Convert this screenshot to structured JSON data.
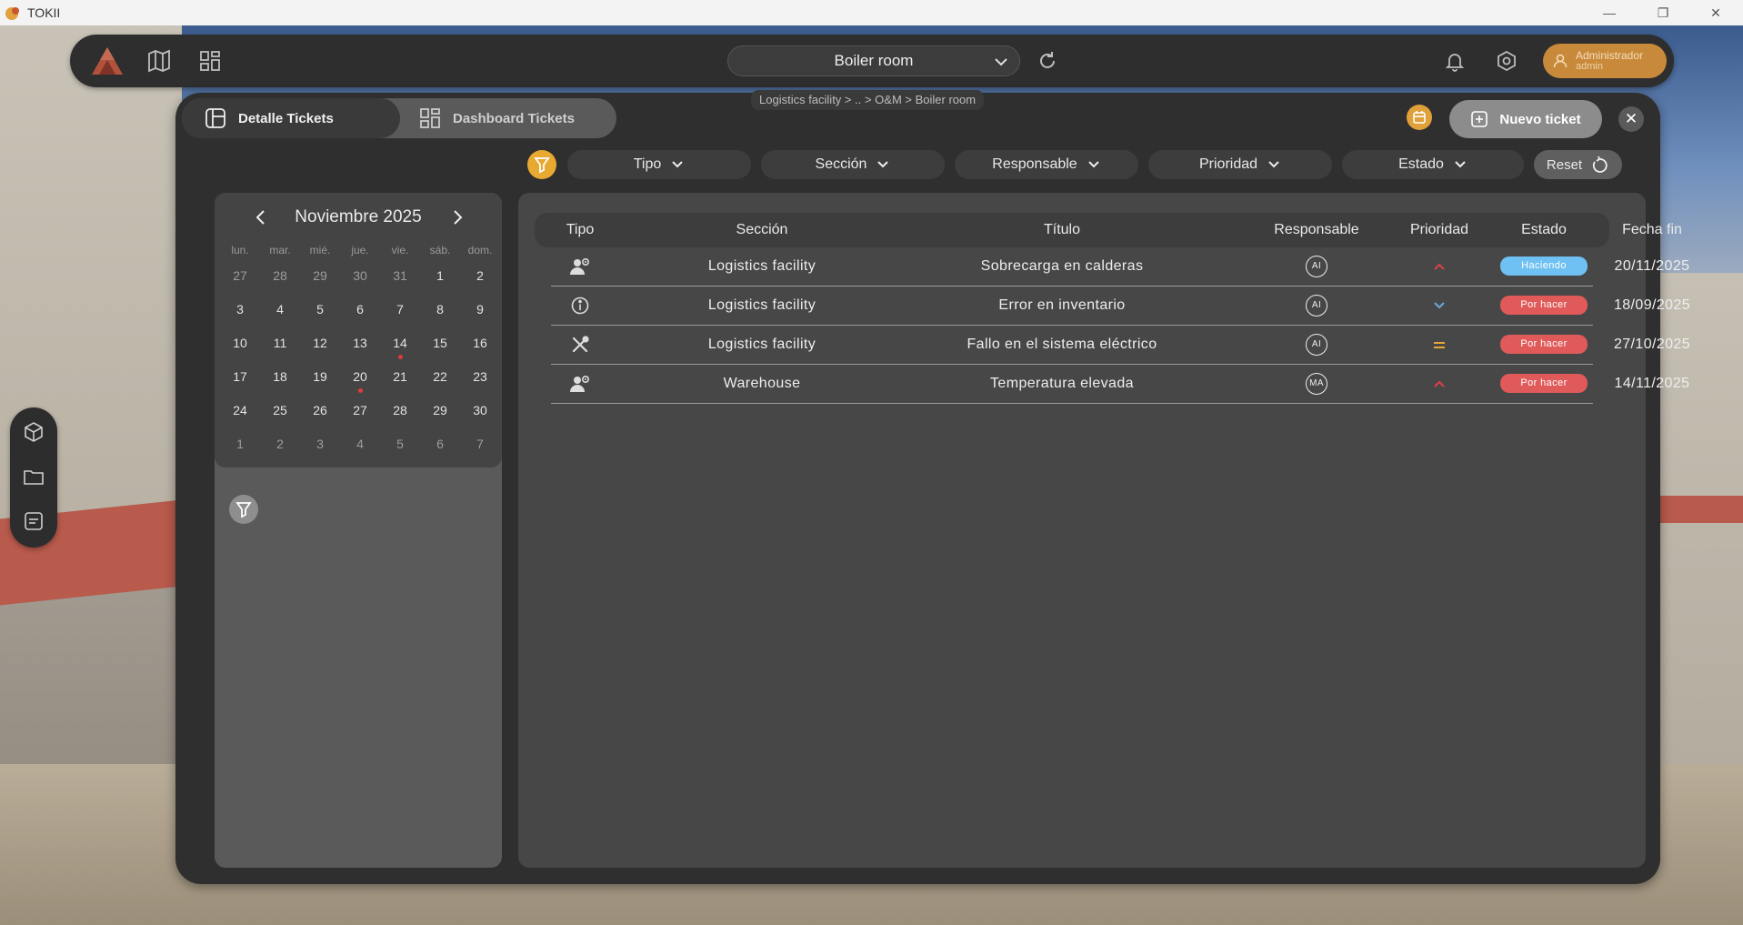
{
  "app": {
    "title": "TOKII"
  },
  "window_controls": {
    "minimize": "—",
    "maximize": "❐",
    "close": "✕"
  },
  "topbar": {
    "room": "Boiler room",
    "user": {
      "name": "Administrador",
      "role": "admin"
    }
  },
  "breadcrumb": "Logistics facility > .. > O&M > Boiler room",
  "tabs": [
    {
      "label": "Detalle Tickets",
      "active": true
    },
    {
      "label": "Dashboard Tickets",
      "active": false
    }
  ],
  "actions": {
    "new_ticket": "Nuevo ticket",
    "close": "✕",
    "reset": "Reset"
  },
  "filters": [
    "Tipo",
    "Sección",
    "Responsable",
    "Prioridad",
    "Estado"
  ],
  "calendar": {
    "month_label": "Noviembre 2025",
    "weekdays": [
      "lun.",
      "mar.",
      "mié.",
      "jue.",
      "vie.",
      "sáb.",
      "dom."
    ],
    "weeks": [
      [
        "27",
        "28",
        "29",
        "30",
        "31",
        "1",
        "2"
      ],
      [
        "3",
        "4",
        "5",
        "6",
        "7",
        "8",
        "9"
      ],
      [
        "10",
        "11",
        "12",
        "13",
        "14",
        "15",
        "16"
      ],
      [
        "17",
        "18",
        "19",
        "20",
        "21",
        "22",
        "23"
      ],
      [
        "24",
        "25",
        "26",
        "27",
        "28",
        "29",
        "30"
      ],
      [
        "1",
        "2",
        "3",
        "4",
        "5",
        "6",
        "7"
      ]
    ],
    "marked_days": [
      "14",
      "20"
    ]
  },
  "table": {
    "headers": [
      "Tipo",
      "Sección",
      "Título",
      "Responsable",
      "Prioridad",
      "Estado",
      "Fecha fin"
    ],
    "rows": [
      {
        "type_icon": "person-gear-icon",
        "section": "Logistics facility",
        "title": "Sobrecarga en calderas",
        "owner": "AI",
        "priority": "high",
        "status": "Haciendo",
        "status_color": "#6ec1f2",
        "due": "20/11/2025"
      },
      {
        "type_icon": "info-icon",
        "section": "Logistics facility",
        "title": "Error en inventario",
        "owner": "AI",
        "priority": "low",
        "status": "Por hacer",
        "status_color": "#e05a5a",
        "due": "18/09/2025"
      },
      {
        "type_icon": "tools-icon",
        "section": "Logistics facility",
        "title": "Fallo en el sistema eléctrico",
        "owner": "AI",
        "priority": "medium",
        "status": "Por hacer",
        "status_color": "#e05a5a",
        "due": "27/10/2025"
      },
      {
        "type_icon": "person-gear-icon",
        "section": "Warehouse",
        "title": "Temperatura elevada",
        "owner": "MA",
        "priority": "high",
        "status": "Por hacer",
        "status_color": "#e05a5a",
        "due": "14/11/2025"
      }
    ]
  },
  "colors": {
    "accent": "#e7a932",
    "priority_high": "#e0404a",
    "priority_low": "#6fa8dc",
    "priority_medium": "#e7a932"
  }
}
